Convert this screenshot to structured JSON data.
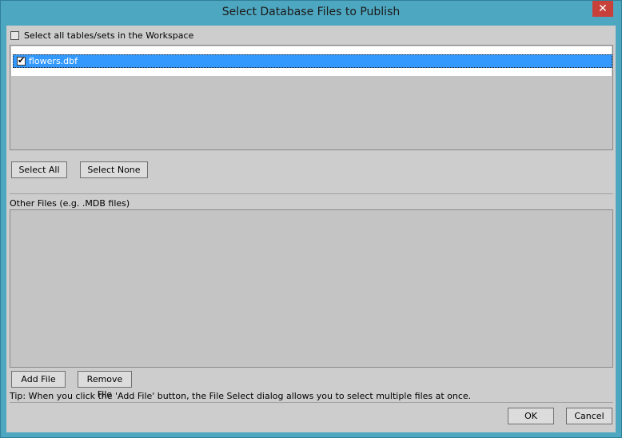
{
  "window": {
    "title": "Select Database Files to Publish",
    "close_glyph": "✕"
  },
  "select_all_workspace": {
    "label": "Select all tables/sets in the Workspace",
    "checked": false
  },
  "tables": {
    "items": [
      {
        "label": "flowers.dbf",
        "checked": true,
        "selected": true
      }
    ]
  },
  "buttons": {
    "select_all": "Select All",
    "select_none": "Select None",
    "add_file": "Add File",
    "remove_file": "Remove File",
    "ok": "OK",
    "cancel": "Cancel"
  },
  "other_files": {
    "label": "Other Files (e.g. .MDB files)",
    "items": []
  },
  "tip": "Tip: When you click the 'Add File' button, the File Select dialog allows you to select multiple files at once."
}
